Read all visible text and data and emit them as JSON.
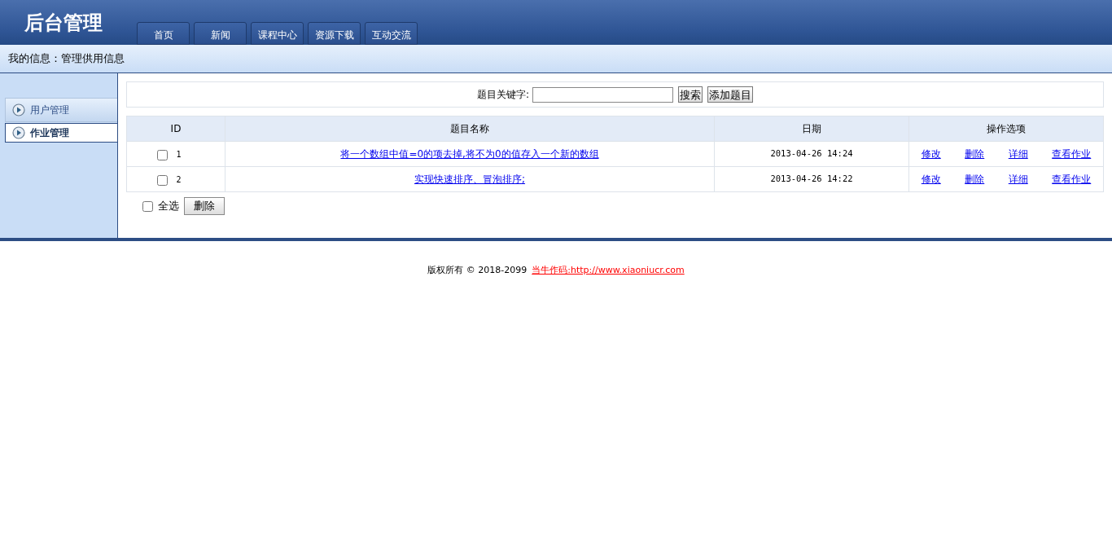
{
  "header": {
    "title": "后台管理",
    "nav": [
      "首页",
      "新闻",
      "课程中心",
      "资源下载",
      "互动交流"
    ]
  },
  "breadcrumb": "我的信息：管理供用信息",
  "sidebar": {
    "items": [
      {
        "label": "用户管理",
        "selected": false
      },
      {
        "label": "作业管理",
        "selected": true
      }
    ]
  },
  "search": {
    "label": "题目关键字:",
    "buttons": [
      "搜索",
      "添加题目"
    ]
  },
  "table": {
    "columns": [
      "ID",
      "题目名称",
      "日期",
      "操作选项"
    ],
    "rows": [
      {
        "checked": false,
        "id": "1",
        "title": "将一个数组中值=0的项去掉,将不为0的值存入一个新的数组",
        "date": "2013-04-26 14:24",
        "actions": [
          "修改",
          "删除",
          "详细",
          "查看作业"
        ]
      },
      {
        "checked": false,
        "id": "2",
        "title": "实现快速排序、冒泡排序;",
        "date": "2013-04-26 14:22",
        "actions": [
          "修改",
          "删除",
          "详细",
          "查看作业"
        ]
      }
    ]
  },
  "bulk": {
    "select_all": {
      "label": "全选",
      "checked": false
    },
    "button": "删除"
  },
  "footer": {
    "text": "版权所有 © 2018-2099",
    "link": "当牛作码:http://www.xiaoniucr.com"
  }
}
